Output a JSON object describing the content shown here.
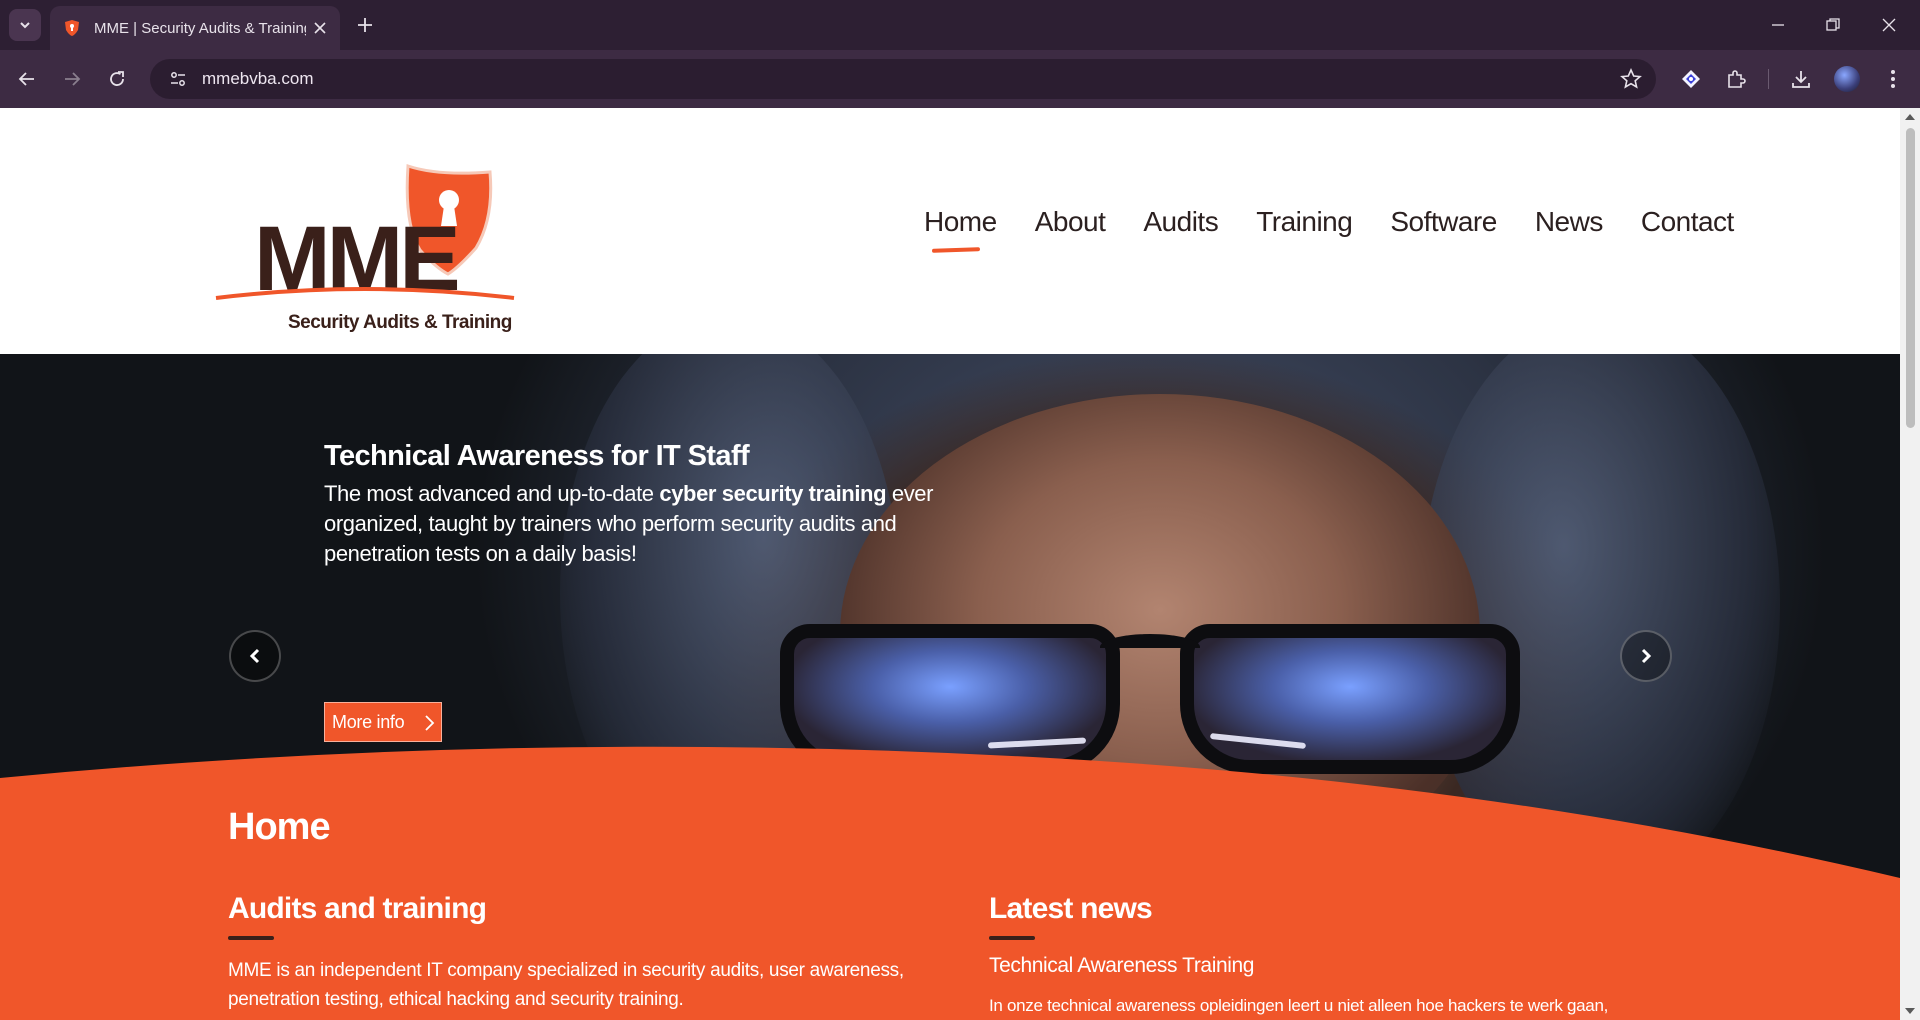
{
  "browser": {
    "tab_title": "MME | Security Audits & Training",
    "url": "mmebvba.com"
  },
  "logo": {
    "wordmark": "MME",
    "tagline": "Security Audits & Training"
  },
  "nav": {
    "items": [
      {
        "label": "Home",
        "active": true
      },
      {
        "label": "About",
        "active": false
      },
      {
        "label": "Audits",
        "active": false
      },
      {
        "label": "Training",
        "active": false
      },
      {
        "label": "Software",
        "active": false
      },
      {
        "label": "News",
        "active": false
      },
      {
        "label": "Contact",
        "active": false
      }
    ]
  },
  "hero": {
    "title": "Technical Awareness for IT Staff",
    "body_before": "The most advanced and up-to-date ",
    "body_bold": "cyber security training",
    "body_after": " ever organized, taught by trainers who perform security audits and penetration tests on a daily basis!",
    "button_label": "More info"
  },
  "content": {
    "page_title": "Home",
    "left_heading": "Audits and training",
    "left_text": "MME is an independent IT company specialized in security audits, user awareness, penetration testing, ethical hacking and security training.",
    "right_heading": "Latest news",
    "news_item_title": "Technical Awareness Training",
    "news_item_text": "In onze technical awareness opleidingen leert u niet alleen hoe hackers te werk gaan,"
  },
  "colors": {
    "brand_orange": "#f0562a",
    "brand_brown": "#3a201a",
    "chrome_dark": "#2d1f33",
    "chrome_toolbar": "#3d2b43"
  }
}
